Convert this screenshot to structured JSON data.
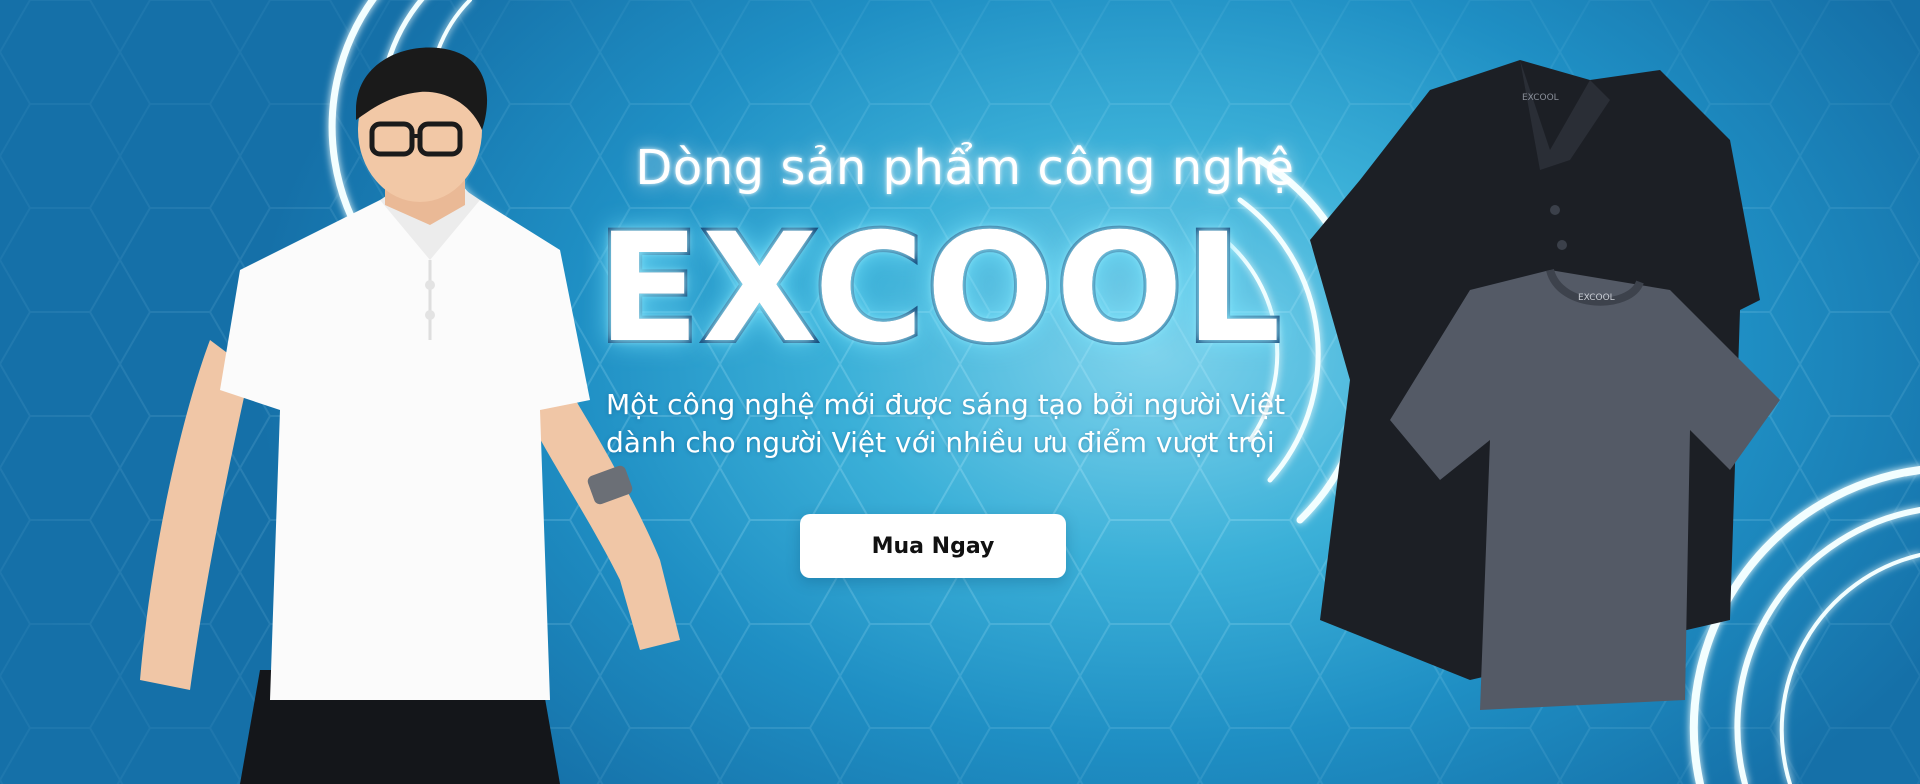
{
  "hero": {
    "kicker": "Dòng sản phẩm công nghệ",
    "brand": "EXCOOL",
    "description_line1": "Một công nghệ mới được sáng tạo bởi người Việt",
    "description_line2": "dành cho người Việt với nhiều ưu điểm vượt trội",
    "cta_label": "Mua Ngay"
  },
  "products": {
    "polo_tag": "EXCOOL",
    "tee_tag": "EXCOOL"
  },
  "colors": {
    "background": "#1f8fc4",
    "glow": "#e8fbff",
    "brand_outline": "#0b3a6e",
    "polo_black": "#1c1f25",
    "tee_grey": "#545a66",
    "button_bg": "#ffffff"
  }
}
